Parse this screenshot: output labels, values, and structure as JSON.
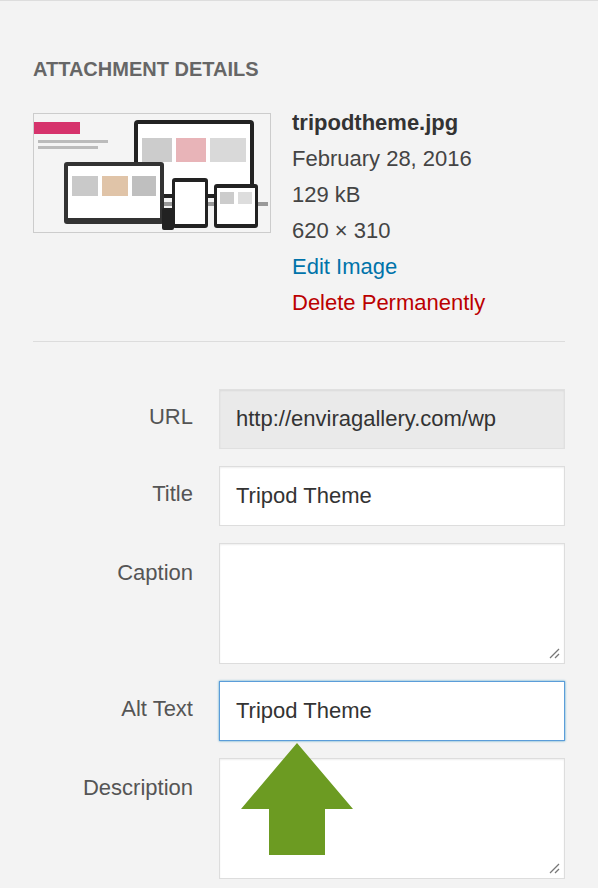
{
  "panel": {
    "title": "ATTACHMENT DETAILS"
  },
  "file": {
    "name": "tripodtheme.jpg",
    "date": "February 28, 2016",
    "size": "129 kB",
    "dimensions": "620 × 310",
    "edit_link": "Edit Image",
    "delete_link": "Delete Permanently"
  },
  "fields": [
    {
      "label": "URL",
      "value": "http://enviragallery.com/wp",
      "kind": "input",
      "readonly": true,
      "focused": false
    },
    {
      "label": "Title",
      "value": "Tripod Theme",
      "kind": "input",
      "readonly": false,
      "focused": false
    },
    {
      "label": "Caption",
      "value": "",
      "kind": "textarea",
      "readonly": false,
      "focused": false
    },
    {
      "label": "Alt Text",
      "value": "Tripod Theme",
      "kind": "input",
      "readonly": false,
      "focused": true
    },
    {
      "label": "Description",
      "value": "",
      "kind": "textarea",
      "readonly": false,
      "focused": false
    }
  ]
}
